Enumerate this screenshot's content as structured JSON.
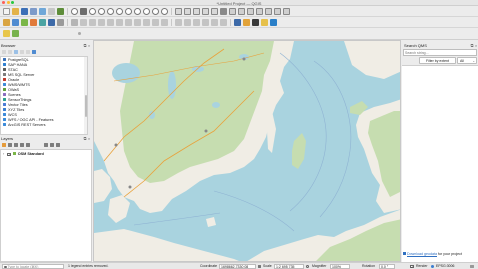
{
  "window": {
    "title": "*Untitled Project — QGIS"
  },
  "browser_panel": {
    "title": "Browser",
    "items": [
      {
        "label": "PostgreSQL",
        "color": "#3a6fb5"
      },
      {
        "label": "SAP HANA",
        "color": "#2d7fd1"
      },
      {
        "label": "STAC",
        "color": "#5a5a5a"
      },
      {
        "label": "MS SQL Server",
        "color": "#7a7a7a"
      },
      {
        "label": "Oracle",
        "color": "#c0392b"
      },
      {
        "label": "WMS/WMTS",
        "color": "#3b8ad9"
      },
      {
        "label": "OWaS",
        "color": "#5e9f3a"
      },
      {
        "label": "Scenes",
        "color": "#8a6bbf"
      },
      {
        "label": "SensorThings",
        "color": "#2d9f8f"
      },
      {
        "label": "Vector Tiles",
        "color": "#4a7bd6"
      },
      {
        "label": "XYZ Tiles",
        "color": "#3c7ed0"
      },
      {
        "label": "WCS",
        "color": "#3b8ad9"
      },
      {
        "label": "WFS / OGC API - Features",
        "color": "#3b8ad9"
      },
      {
        "label": "ArcGIS REST Servers",
        "color": "#3b8ad9"
      }
    ]
  },
  "layers_panel": {
    "title": "Layers",
    "layer": {
      "name": "OSM Standard",
      "checked": true
    }
  },
  "search_panel": {
    "title": "Search QMS",
    "search_placeholder": "Search string...",
    "filter_button": "Filter by extent",
    "filter_select": "All",
    "download_link": "Download geodata",
    "download_suffix": " for your project"
  },
  "status": {
    "locate_placeholder": "Type to locate (⌘K)",
    "message": "1 legend entries removed.",
    "coordinate_label": "Coordinate",
    "coordinate_value": "1698662,7330 08",
    "scale_label": "Scale",
    "scale_value": "1:2 695 735",
    "magnifier_label": "Magnifier",
    "magnifier_value": "100%",
    "rotation_label": "Rotation",
    "rotation_value": "0,0 °",
    "render_label": "Render",
    "crs": "EPSG:3006"
  },
  "colors": {
    "sea": "#a9d3df",
    "land": "#f0ede5",
    "forest": "#c6ddb0",
    "accent_link": "#2f6fc1"
  }
}
